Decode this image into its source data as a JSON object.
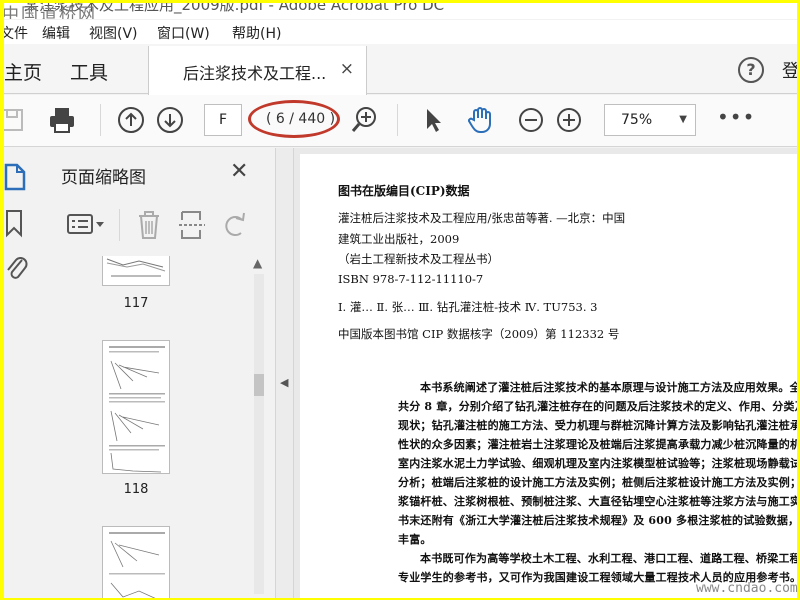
{
  "window": {
    "title_fragment": "某注浆技术及工程应用_2009版.pdf - Adobe Acrobat Pro DC",
    "site_watermark_top": "中国道桥网"
  },
  "menu": {
    "items": [
      {
        "label": "文件"
      },
      {
        "label": "编辑"
      },
      {
        "label": "视图(V)"
      },
      {
        "label": "窗口(W)"
      },
      {
        "label": "帮助(H)"
      }
    ]
  },
  "tabs": {
    "home": "主页",
    "tools": "工具",
    "document": "后注浆技术及工程...",
    "close_glyph": "×",
    "help_glyph": "?",
    "login_fragment": "登"
  },
  "toolbar": {
    "page_input": "F",
    "page_count": "( 6 / 440 )",
    "zoom": "75%",
    "more": "•••",
    "highlight_color": "#c0392b",
    "accent_color": "#2c6fb8"
  },
  "panel": {
    "title": "页面缩略图",
    "thumbnails": [
      {
        "label": "117"
      },
      {
        "label": "118"
      },
      {
        "label": ""
      }
    ]
  },
  "document": {
    "cip_title": "图书在版编目(CIP)数据",
    "cip_lines": [
      "灌注桩后注浆技术及工程应用/张忠苗等著. —北京：中国",
      "建筑工业出版社，2009",
      "（岩土工程新技术及工程丛书）",
      "ISBN 978-7-112-11110-7",
      "Ⅰ. 灌…   Ⅱ. 张…   Ⅲ. 钻孔灌注桩-技术   Ⅳ. TU753. 3",
      "中国版本图书馆 CIP 数据核字（2009）第 112332 号"
    ],
    "body_lines": [
      "本书系统阐述了灌注桩后注浆技术的基本原理与设计施工方法及应用效果。全",
      "共分 8 章，分别介绍了钻孔灌注桩存在的问题及后注浆技术的定义、作用、分类及研",
      "现状；钻孔灌注桩的施工方法、受力机理与群桩沉降计算方法及影响钻孔灌注桩承",
      "性状的众多因素；灌注桩岩土注浆理论及桩端后注浆提高承载力减少桩沉降量的机理",
      "室内注浆水泥土力学试验、细观机理及室内注浆模型桩试验等；注浆桩现场静载试",
      "分析；桩端后注浆桩的设计施工方法及实例；桩侧后注浆桩设计施工方法及实例；",
      "浆锚杆桩、注浆树根桩、预制桩注浆、大直径钻埋空心注浆桩等注浆方法与施工实例",
      "书末还附有《浙江大学灌注桩后注浆技术规程》及 600 多根注浆桩的试验数据，内",
      "丰富。",
      "本书既可作为高等学校土木工程、水利工程、港口工程、道路工程、桥梁工程",
      "专业学生的参考书，又可作为我国建设工程领域大量工程技术人员的应用参考书。"
    ],
    "site_watermark": "www.cndao.com"
  }
}
